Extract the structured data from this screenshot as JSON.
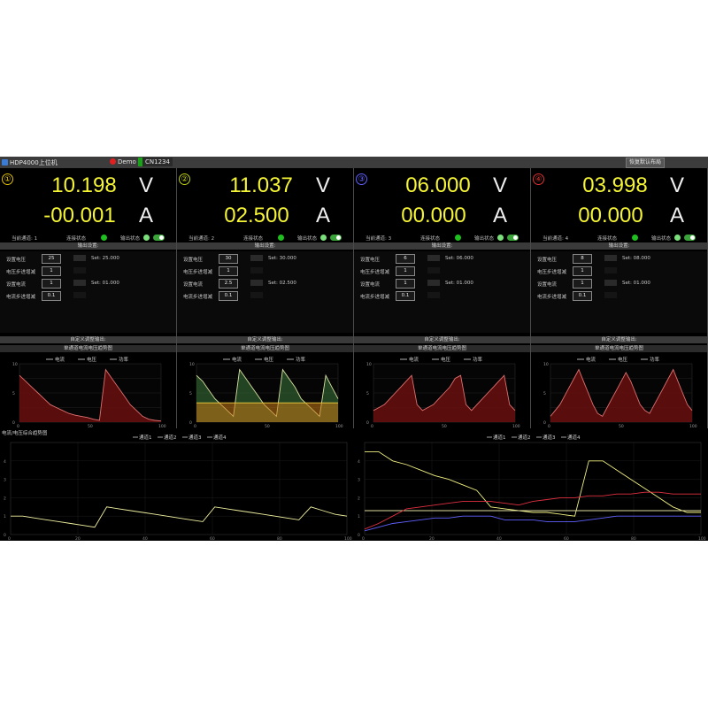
{
  "app": {
    "title": "HDP4000上位机",
    "demo_label": "Demo",
    "port_label": "CN1234",
    "restore_button": "恢复默认布局"
  },
  "labels": {
    "current_channel": "当前通道:",
    "connection_status": "连接状态",
    "output_status": "输出状态",
    "output_settings": "输出设置:",
    "set_voltage": "设置电压",
    "voltage_step": "电压步进增减",
    "set_current": "设置电流",
    "current_step": "电流步进增减",
    "auto_adjust": "自定义调整输出:",
    "single_chart_title": "单通道电流电压趋势图",
    "legend_current": "电流",
    "legend_voltage": "电压",
    "legend_power": "功率",
    "bottom_title": "电流/电压综合趋势图"
  },
  "channels": [
    {
      "num": "①",
      "color": "#e0c000",
      "voltage": "10.198",
      "current": "-00.001",
      "unit_v": "V",
      "unit_a": "A",
      "channel_index": "1",
      "set_voltage": "25",
      "set_voltage_readback": "Set: 25.000",
      "voltage_step": "1",
      "set_current": "1",
      "set_current_readback": "Set: 01.000",
      "current_step": "0.1"
    },
    {
      "num": "②",
      "color": "#c0d010",
      "voltage": "11.037",
      "current": "02.500",
      "unit_v": "V",
      "unit_a": "A",
      "channel_index": "2",
      "set_voltage": "30",
      "set_voltage_readback": "Set: 30.000",
      "voltage_step": "1",
      "set_current": "2.5",
      "set_current_readback": "Set: 02.500",
      "current_step": "0.1"
    },
    {
      "num": "③",
      "color": "#6060ff",
      "voltage": "06.000",
      "current": "00.000",
      "unit_v": "V",
      "unit_a": "A",
      "channel_index": "3",
      "set_voltage": "6",
      "set_voltage_readback": "Set: 06.000",
      "voltage_step": "1",
      "set_current": "1",
      "set_current_readback": "Set: 01.000",
      "current_step": "0.1"
    },
    {
      "num": "④",
      "color": "#e03030",
      "voltage": "03.998",
      "current": "00.000",
      "unit_v": "V",
      "unit_a": "A",
      "channel_index": "4",
      "set_voltage": "8",
      "set_voltage_readback": "Set: 08.000",
      "voltage_step": "1",
      "set_current": "1",
      "set_current_readback": "Set: 01.000",
      "current_step": "0.1"
    }
  ],
  "chart_data": [
    {
      "type": "line",
      "title": "单通道电流电压趋势图",
      "series": [
        {
          "name": "电流",
          "values": [
            8,
            7,
            6,
            5,
            4,
            3,
            2.5,
            2,
            1.5,
            1.2,
            1,
            0.8,
            0.5,
            0.3,
            9,
            7.5,
            6,
            4.5,
            3,
            2,
            1,
            0.5,
            0.3,
            0.2
          ]
        },
        {
          "name": "电压",
          "values": []
        },
        {
          "name": "功率",
          "values": []
        }
      ]
    },
    {
      "type": "line",
      "title": "单通道电流电压趋势图",
      "series": [
        {
          "name": "电流",
          "values": [
            8,
            7,
            5.5,
            4,
            3,
            2,
            1,
            9,
            7.5,
            6,
            4.5,
            3,
            2,
            1,
            9,
            7.5,
            6,
            4,
            3,
            2,
            1,
            8,
            6,
            4
          ]
        },
        {
          "name": "电压",
          "values": [
            2.5,
            2.5,
            2.5,
            2.5,
            2.5,
            2.5,
            2.5,
            2.5,
            2.5,
            2.5,
            2.5,
            2.5,
            2.5,
            2.5,
            2.5,
            2.5,
            2.5,
            2.5,
            2.5,
            2.5,
            2.5,
            2.5,
            2.5,
            2.5
          ]
        },
        {
          "name": "功率",
          "values": []
        }
      ]
    },
    {
      "type": "line",
      "title": "单通道电流电压趋势图",
      "series": [
        {
          "name": "电流",
          "values": [
            2,
            2.5,
            3,
            4,
            5,
            6,
            7,
            8,
            3,
            2,
            2.5,
            3,
            4,
            5,
            6,
            7.5,
            8,
            3,
            2,
            3,
            4,
            5,
            6,
            7,
            8,
            3,
            2
          ]
        },
        {
          "name": "电压",
          "values": []
        },
        {
          "name": "功率",
          "values": []
        }
      ]
    },
    {
      "type": "line",
      "title": "单通道电流电压趋势图",
      "series": [
        {
          "name": "电流",
          "values": [
            1,
            2,
            3,
            4.5,
            6,
            7.5,
            9,
            7,
            5,
            3,
            1.5,
            1,
            2.5,
            4,
            5.5,
            7,
            8.5,
            7,
            5,
            3,
            2,
            1.5,
            3,
            4.5,
            6,
            7.5,
            9,
            7,
            5,
            3,
            2
          ]
        },
        {
          "name": "电压",
          "values": []
        },
        {
          "name": "功率",
          "values": []
        }
      ]
    },
    {
      "type": "line",
      "title": "电流/电压综合趋势图",
      "legend": [
        "通道1",
        "通道2",
        "通道3",
        "通道4"
      ],
      "series": [
        {
          "name": "通道1",
          "values": [
            1,
            1,
            0.9,
            0.8,
            0.7,
            0.6,
            0.5,
            0.4,
            1.5,
            1.4,
            1.3,
            1.2,
            1.1,
            1,
            0.9,
            0.8,
            0.7,
            1.5,
            1.4,
            1.3,
            1.2,
            1.1,
            1,
            0.9,
            0.8,
            1.5,
            1.3,
            1.1,
            1
          ]
        }
      ],
      "x_ticks": [
        "0",
        "20",
        "40",
        "60",
        "80",
        "100"
      ],
      "y_ticks": [
        "0",
        "1",
        "2",
        "3",
        "4"
      ]
    },
    {
      "type": "line",
      "legend": [
        "通道1",
        "通道2",
        "通道3",
        "通道4"
      ],
      "series": [
        {
          "name": "通道1",
          "values": [
            4.5,
            4.5,
            4,
            3.8,
            3.5,
            3.2,
            3,
            2.7,
            2.4,
            1.5,
            1.4,
            1.3,
            1.2,
            1.2,
            1.1,
            1.0,
            4,
            4,
            3.5,
            3,
            2.5,
            2,
            1.5,
            1.2,
            1.2
          ]
        },
        {
          "name": "通道2",
          "values": [
            1.3,
            1.3,
            1.3,
            1.3,
            1.3,
            1.3,
            1.3,
            1.3,
            1.3,
            1.3,
            1.3,
            1.3,
            1.3,
            1.3,
            1.3,
            1.3,
            1.3,
            1.3,
            1.3,
            1.3,
            1.3,
            1.3,
            1.3,
            1.3,
            1.3
          ]
        },
        {
          "name": "通道3",
          "values": [
            0.2,
            0.4,
            0.6,
            0.7,
            0.8,
            0.9,
            0.9,
            1,
            1,
            1,
            0.8,
            0.8,
            0.8,
            0.7,
            0.7,
            0.7,
            0.8,
            0.9,
            1,
            1,
            1,
            1,
            1,
            1,
            1
          ]
        },
        {
          "name": "通道4",
          "values": [
            0.3,
            0.6,
            1,
            1.4,
            1.5,
            1.6,
            1.7,
            1.8,
            1.8,
            1.8,
            1.7,
            1.6,
            1.8,
            1.9,
            2,
            2,
            2.1,
            2.1,
            2.2,
            2.2,
            2.3,
            2.3,
            2.2,
            2.2,
            2.2
          ]
        }
      ],
      "x_ticks": [
        "0",
        "20",
        "40",
        "60",
        "80",
        "100"
      ],
      "y_ticks": [
        "0",
        "1",
        "2",
        "3",
        "4"
      ]
    }
  ]
}
